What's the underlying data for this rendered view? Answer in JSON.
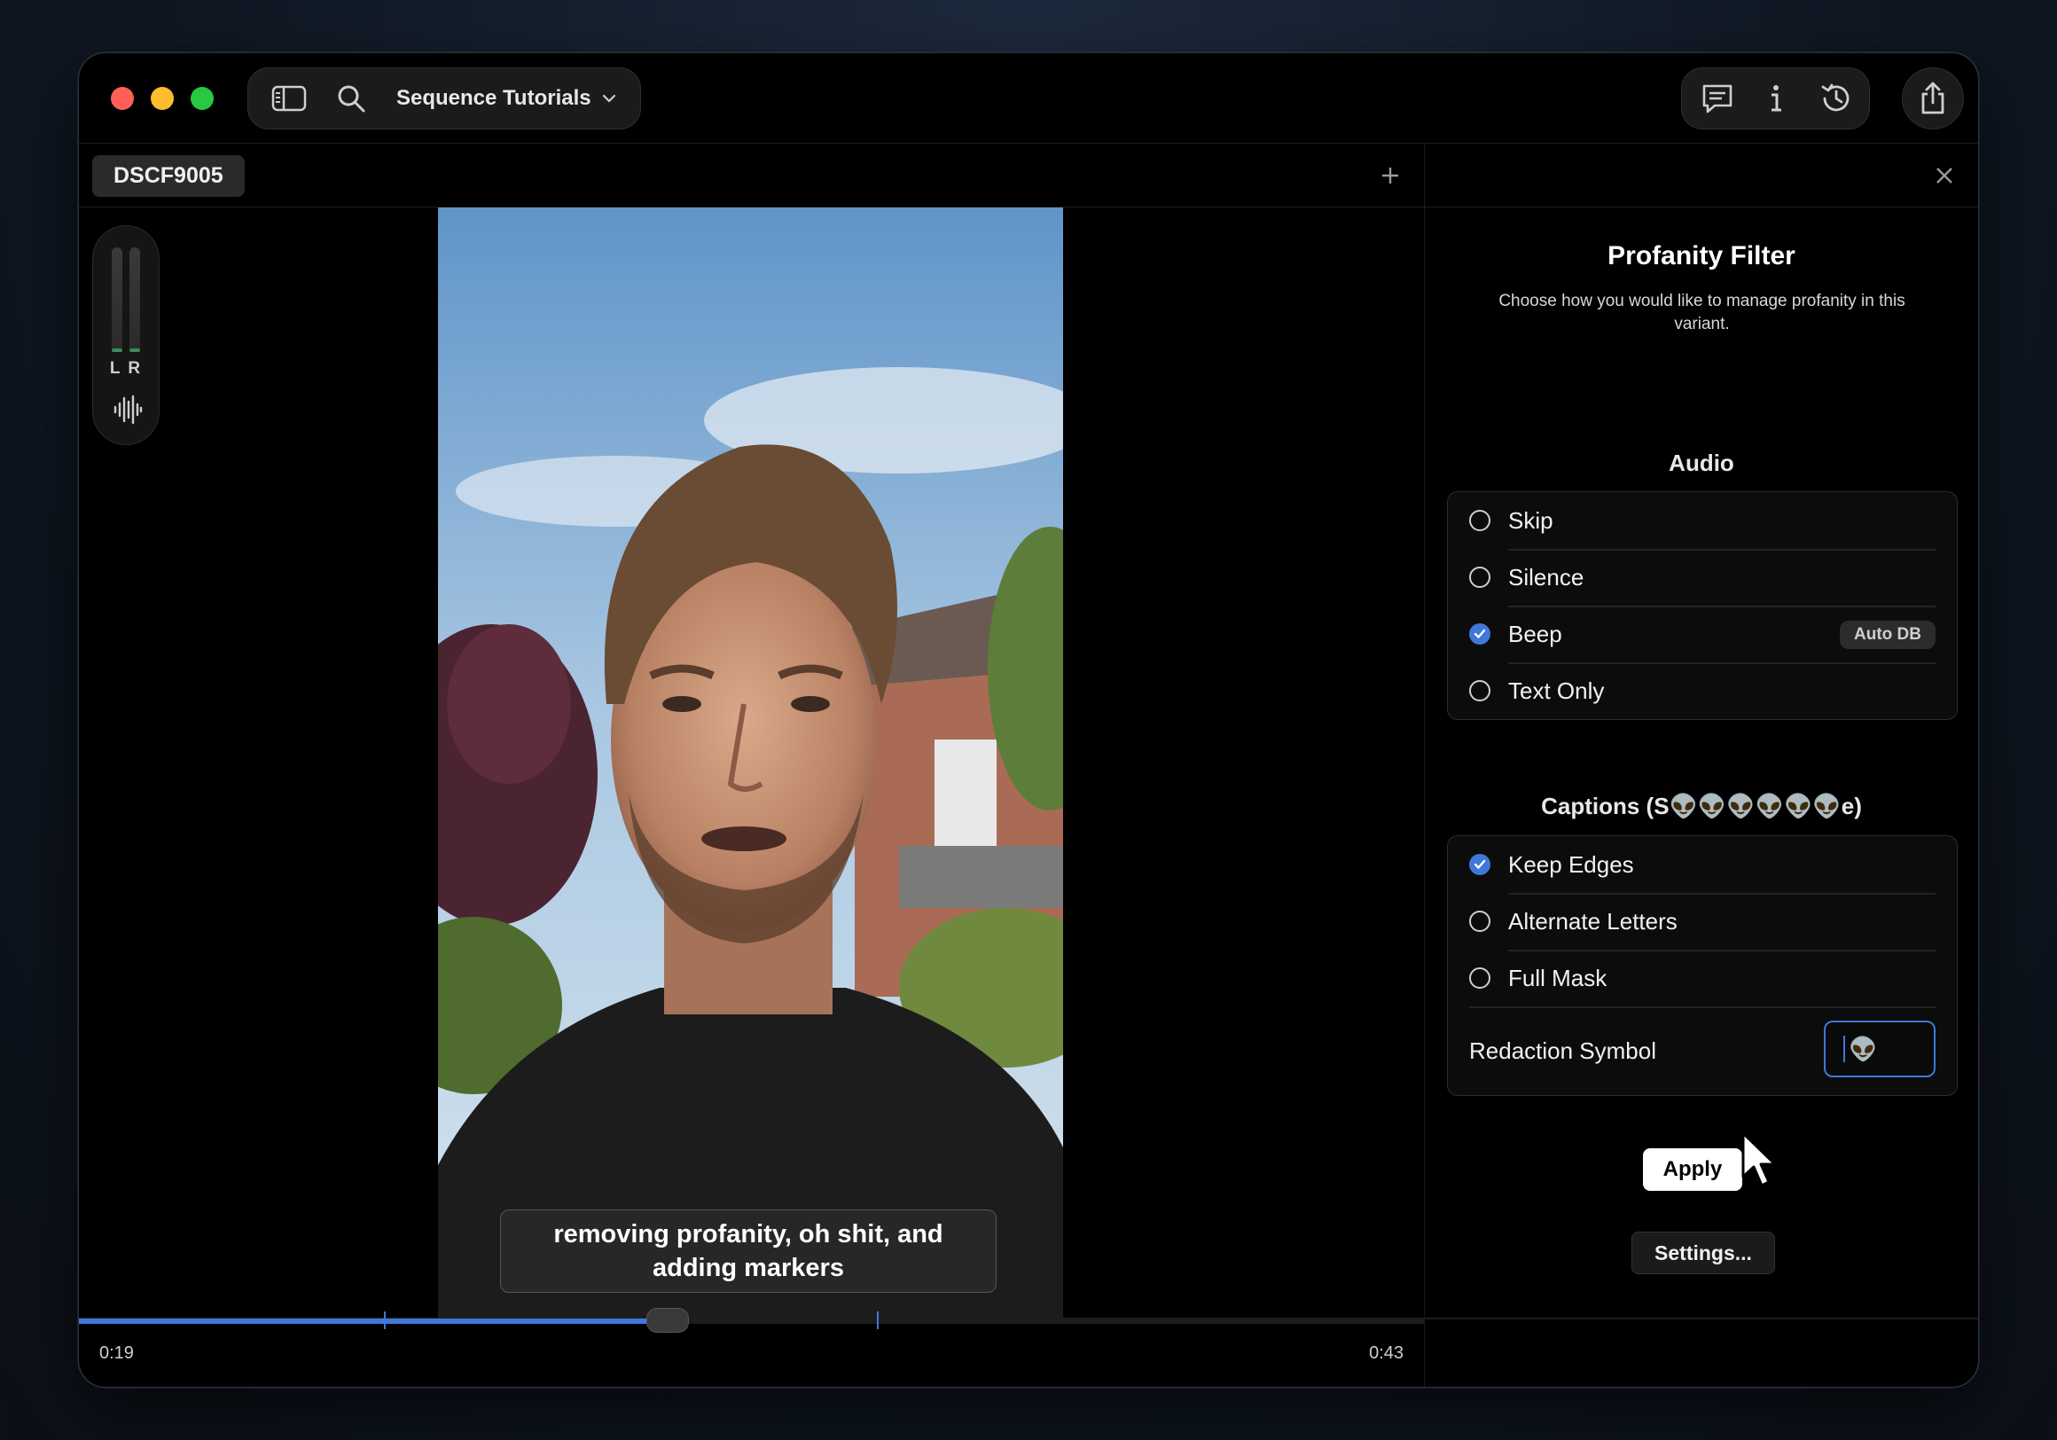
{
  "toolbar": {
    "project_name": "Sequence Tutorials",
    "icons": [
      "sidebar-toggle-icon",
      "search-icon",
      "chevron-down-icon",
      "captions-icon",
      "info-icon",
      "history-icon",
      "share-icon"
    ]
  },
  "editor": {
    "clip_tab": "DSCF9005",
    "meter_label": "L R",
    "caption_text": "removing profanity, oh shit, and adding markers",
    "current_time": "0:19",
    "total_time": "0:43",
    "progress": 0.438,
    "marker_positions": [
      0.227,
      0.593
    ]
  },
  "panel": {
    "title": "Profanity Filter",
    "description": "Choose how you would like to manage profanity in this variant.",
    "audio": {
      "title": "Audio",
      "options": [
        {
          "label": "Skip",
          "selected": false
        },
        {
          "label": "Silence",
          "selected": false
        },
        {
          "label": "Beep",
          "selected": true,
          "badge": "Auto DB"
        },
        {
          "label": "Text Only",
          "selected": false
        }
      ]
    },
    "captions": {
      "title": "Captions (S👽👽👽👽👽👽e)",
      "options": [
        {
          "label": "Keep Edges",
          "selected": true
        },
        {
          "label": "Alternate Letters",
          "selected": false
        },
        {
          "label": "Full Mask",
          "selected": false
        }
      ],
      "redaction_label": "Redaction Symbol",
      "redaction_value": "👽"
    },
    "apply_label": "Apply",
    "settings_label": "Settings..."
  },
  "colors": {
    "accent": "#3f78d8",
    "close": "#ff5f57",
    "minimize": "#febc2e",
    "zoom": "#28c840"
  }
}
